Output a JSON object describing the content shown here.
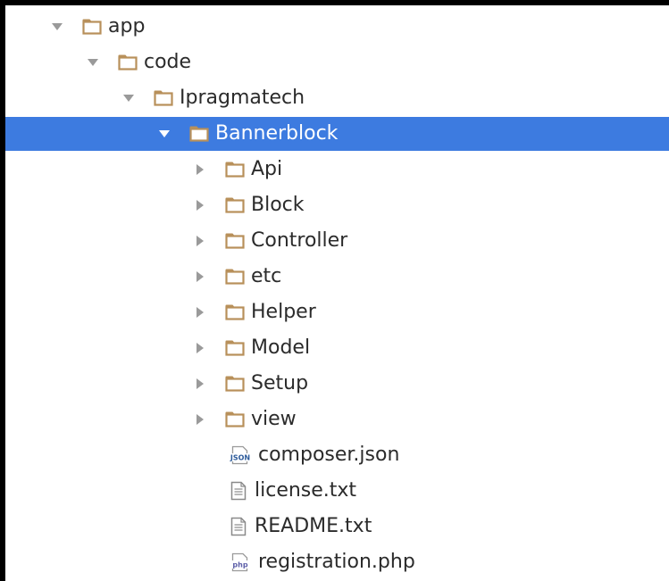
{
  "tree": {
    "items": [
      {
        "label": "app",
        "type": "folder",
        "state": "expanded",
        "depth": 0
      },
      {
        "label": "code",
        "type": "folder",
        "state": "expanded",
        "depth": 1
      },
      {
        "label": "Ipragmatech",
        "type": "folder",
        "state": "expanded",
        "depth": 2
      },
      {
        "label": "Bannerblock",
        "type": "folder",
        "state": "expanded",
        "depth": 3,
        "selected": true
      },
      {
        "label": "Api",
        "type": "folder",
        "state": "collapsed",
        "depth": 4
      },
      {
        "label": "Block",
        "type": "folder",
        "state": "collapsed",
        "depth": 4
      },
      {
        "label": "Controller",
        "type": "folder",
        "state": "collapsed",
        "depth": 4
      },
      {
        "label": "etc",
        "type": "folder",
        "state": "collapsed",
        "depth": 4
      },
      {
        "label": "Helper",
        "type": "folder",
        "state": "collapsed",
        "depth": 4
      },
      {
        "label": "Model",
        "type": "folder",
        "state": "collapsed",
        "depth": 4
      },
      {
        "label": "Setup",
        "type": "folder",
        "state": "collapsed",
        "depth": 4
      },
      {
        "label": "view",
        "type": "folder",
        "state": "collapsed",
        "depth": 4
      },
      {
        "label": "composer.json",
        "type": "json-file",
        "depth": 4,
        "icon_text": "JSON"
      },
      {
        "label": "license.txt",
        "type": "text-file",
        "depth": 4
      },
      {
        "label": "README.txt",
        "type": "text-file",
        "depth": 4
      },
      {
        "label": "registration.php",
        "type": "php-file",
        "depth": 4,
        "icon_text": "php"
      }
    ]
  },
  "colors": {
    "selection": "#3d7be0",
    "folder_outline": "#b8905a",
    "folder_fill": "#ffffff",
    "arrow_gray": "#9a9a9a",
    "text": "#2b2b2b",
    "text_selected": "#ffffff"
  }
}
